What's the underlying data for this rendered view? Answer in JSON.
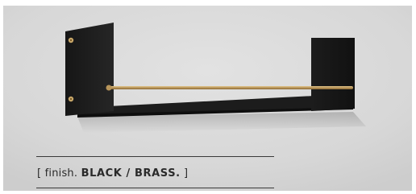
{
  "caption": {
    "open_bracket": "[",
    "label": "finish.",
    "value": "BLACK / BRASS.",
    "close_bracket": "]"
  },
  "colors": {
    "background": "#d9d9d9",
    "shelf": "#1e1e1e",
    "rail": "#b8955a",
    "text": "#2a2a2a"
  }
}
